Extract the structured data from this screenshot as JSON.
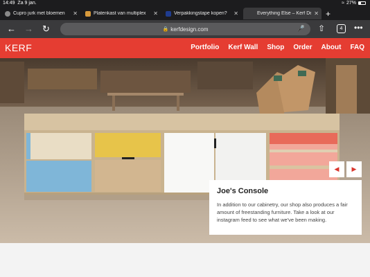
{
  "status_bar": {
    "time": "14:49",
    "date": "Za 9 jan.",
    "battery": "27%"
  },
  "tabs": [
    {
      "label": "Cupro jurk met bloemen",
      "favicon_color": "#8a8a8a",
      "active": false
    },
    {
      "label": "Platenkast van multiplex",
      "favicon_color": "#d79a3c",
      "active": false
    },
    {
      "label": "Verpakkingstape kopen?",
      "favicon_color": "#1f3c8f",
      "active": false
    },
    {
      "label": "Everything Else – Kerf De",
      "favicon_color": "",
      "active": true
    }
  ],
  "toolbar": {
    "url": "kerfdesign.com",
    "tab_count": "4"
  },
  "site": {
    "logo": "KERF",
    "nav": [
      "Portfolio",
      "Kerf Wall",
      "Shop",
      "Order",
      "About",
      "FAQ"
    ]
  },
  "hero": {
    "title": "Joe's Console",
    "body": "In addition to our cabinetry, our shop also produces a fair amount of freestanding furniture. Take a look at our instagram feed to see what we've been making."
  },
  "colors": {
    "brand_red": "#e53d32",
    "chrome_dark": "#1c1c1e",
    "chrome_mid": "#3a3a3c"
  }
}
